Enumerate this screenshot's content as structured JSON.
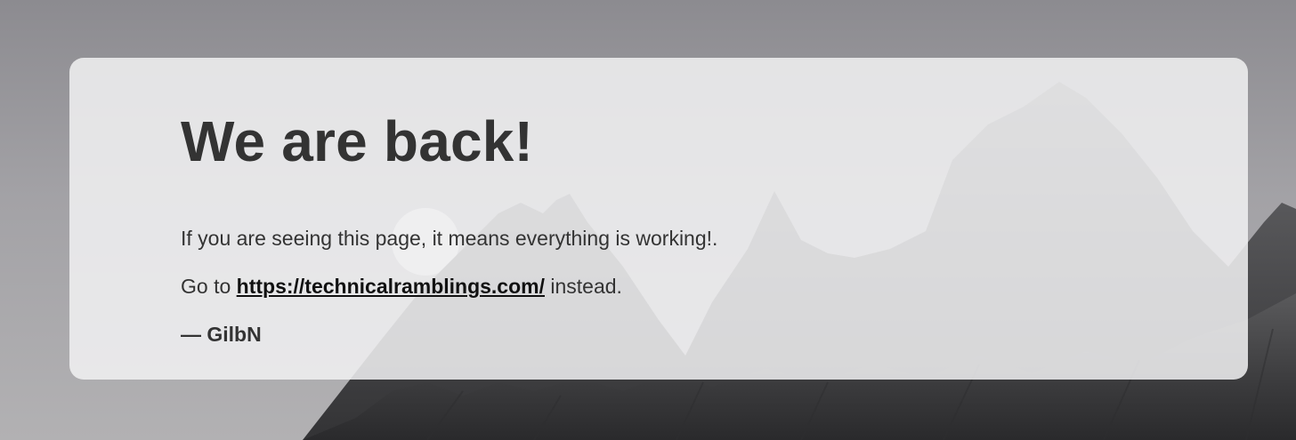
{
  "heading": "We are back!",
  "message": "If you are seeing this page, it means everything is working!.",
  "redirect": {
    "prefix": "Go to ",
    "link_text": "https://technicalramblings.com/",
    "suffix": " instead."
  },
  "signature": "— GilbN",
  "colors": {
    "text": "#333333",
    "card_background": "#f1f1f2"
  }
}
